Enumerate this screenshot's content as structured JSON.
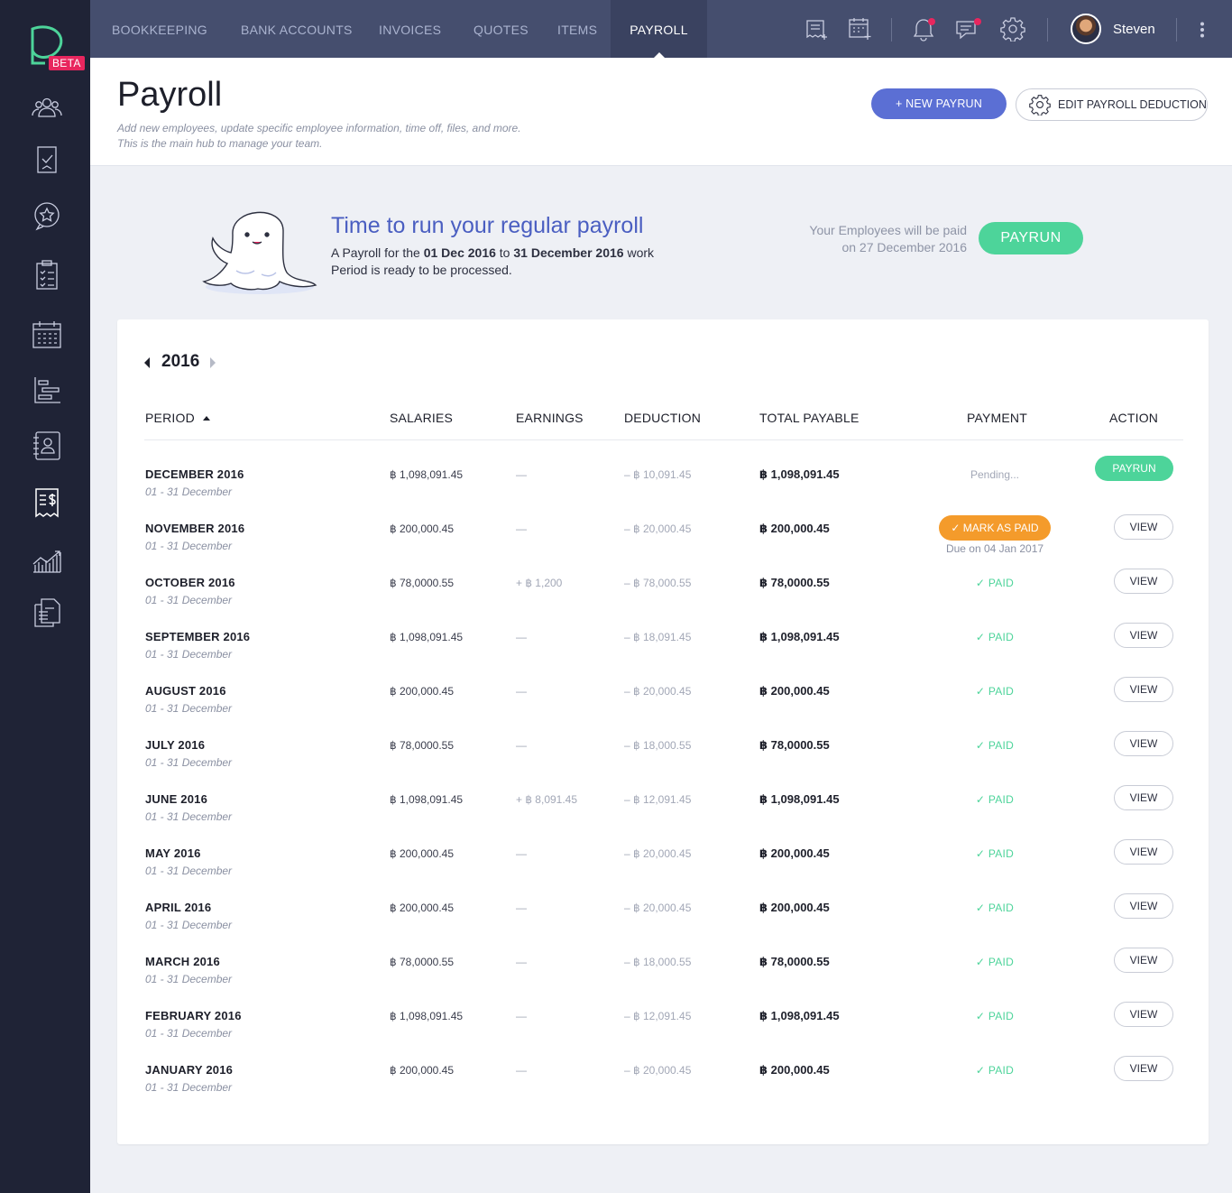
{
  "brand": {
    "beta_badge": "BETA",
    "accent": "#4dd49a",
    "primary": "#5b6fd4",
    "warning": "#f49b2b",
    "alert": "#e8265e"
  },
  "sidebar": {
    "icons": [
      "logo-icon",
      "team-icon",
      "tasks-icon",
      "favorites-chat-icon",
      "checklist-icon",
      "calendar-icon",
      "timeline-icon",
      "contacts-icon",
      "payroll-receipt-icon",
      "analytics-icon",
      "documents-icon"
    ]
  },
  "topnav": {
    "tabs": [
      {
        "label": "BOOKKEEPING"
      },
      {
        "label": "BANK ACCOUNTS"
      },
      {
        "label": "INVOICES"
      },
      {
        "label": "QUOTES"
      },
      {
        "label": "ITEMS"
      },
      {
        "label": "PAYROLL",
        "active": true
      }
    ],
    "user": {
      "name": "Steven"
    },
    "icons": [
      "add-note-icon",
      "add-event-icon",
      "notification-bell-icon",
      "chat-icon",
      "settings-gear-icon",
      "kebab-menu-icon"
    ]
  },
  "header": {
    "title": "Payroll",
    "subtitle_line1": "Add new employees, update specific employee information, time off, files, and more.",
    "subtitle_line2": "This is the main hub to manage your team.",
    "new_payrun_label": "+ NEW PAYRUN",
    "edit_deduction_label": "EDIT PAYROLL DEDUCTION"
  },
  "banner": {
    "title": "Time to run your regular payroll",
    "text_prefix": "A Payroll for the ",
    "date_start": "01 Dec 2016",
    "text_to": " to ",
    "date_end": "31 December 2016",
    "text_suffix": " work",
    "text_line2": "Period is ready to be processed.",
    "paid_line1": "Your Employees will be paid",
    "paid_line2": "on 27 December 2016",
    "payrun_label": "PAYRUN"
  },
  "table": {
    "year": "2016",
    "columns": {
      "period": "PERIOD",
      "salaries": "SALARIES",
      "earnings": "EARNINGS",
      "deduction": "DEDUCTION",
      "total": "TOTAL PAYABLE",
      "payment": "PAYMENT",
      "action": "ACTION"
    },
    "rows": [
      {
        "period": "DECEMBER 2016",
        "range": "01 - 31 December",
        "salaries": "฿ 1,098,091.45",
        "earnings": "—",
        "deduction": "– ฿ 10,091.45",
        "total": "฿ 1,098,091.45",
        "payment": "Pending...",
        "action": "PAYRUN"
      },
      {
        "period": "NOVEMBER 2016",
        "range": "01 - 31 December",
        "salaries": "฿ 200,000.45",
        "earnings": "—",
        "deduction": "– ฿ 20,000.45",
        "total": "฿ 200,000.45",
        "payment": "✓ MARK AS PAID",
        "due": "Due on 04 Jan 2017",
        "action": "VIEW"
      },
      {
        "period": "OCTOBER 2016",
        "range": "01 - 31 December",
        "salaries": "฿ 78,0000.55",
        "earnings": "+ ฿ 1,200",
        "deduction": "– ฿ 78,000.55",
        "total": "฿ 78,0000.55",
        "payment": "✓   PAID",
        "action": "VIEW"
      },
      {
        "period": "SEPTEMBER 2016",
        "range": "01 - 31 December",
        "salaries": "฿ 1,098,091.45",
        "earnings": "—",
        "deduction": "– ฿ 18,091.45",
        "total": "฿ 1,098,091.45",
        "payment": "✓   PAID",
        "action": "VIEW"
      },
      {
        "period": "AUGUST 2016",
        "range": "01 - 31 December",
        "salaries": "฿ 200,000.45",
        "earnings": "—",
        "deduction": "– ฿ 20,000.45",
        "total": "฿ 200,000.45",
        "payment": "✓   PAID",
        "action": "VIEW"
      },
      {
        "period": "JULY 2016",
        "range": "01 - 31 December",
        "salaries": "฿ 78,0000.55",
        "earnings": "—",
        "deduction": "– ฿ 18,000.55",
        "total": "฿ 78,0000.55",
        "payment": "✓   PAID",
        "action": "VIEW"
      },
      {
        "period": "JUNE 2016",
        "range": "01 - 31 December",
        "salaries": "฿ 1,098,091.45",
        "earnings": "+ ฿ 8,091.45",
        "deduction": "– ฿ 12,091.45",
        "total": "฿ 1,098,091.45",
        "payment": "✓   PAID",
        "action": "VIEW"
      },
      {
        "period": "MAY 2016",
        "range": "01 - 31 December",
        "salaries": "฿ 200,000.45",
        "earnings": "—",
        "deduction": "– ฿ 20,000.45",
        "total": "฿ 200,000.45",
        "payment": "✓   PAID",
        "action": "VIEW"
      },
      {
        "period": "APRIL 2016",
        "range": "01 - 31 December",
        "salaries": "฿ 200,000.45",
        "earnings": "—",
        "deduction": "– ฿ 20,000.45",
        "total": "฿ 200,000.45",
        "payment": "✓   PAID",
        "action": "VIEW"
      },
      {
        "period": "MARCH 2016",
        "range": "01 - 31 December",
        "salaries": "฿ 78,0000.55",
        "earnings": "—",
        "deduction": "– ฿ 18,000.55",
        "total": "฿ 78,0000.55",
        "payment": "✓   PAID",
        "action": "VIEW"
      },
      {
        "period": "FEBRUARY 2016",
        "range": "01 - 31 December",
        "salaries": "฿ 1,098,091.45",
        "earnings": "—",
        "deduction": "– ฿ 12,091.45",
        "total": "฿ 1,098,091.45",
        "payment": "✓   PAID",
        "action": "VIEW"
      },
      {
        "period": "JANUARY 2016",
        "range": "01 - 31 December",
        "salaries": "฿ 200,000.45",
        "earnings": "—",
        "deduction": "– ฿ 20,000.45",
        "total": "฿ 200,000.45",
        "payment": "✓   PAID",
        "action": "VIEW"
      }
    ]
  }
}
